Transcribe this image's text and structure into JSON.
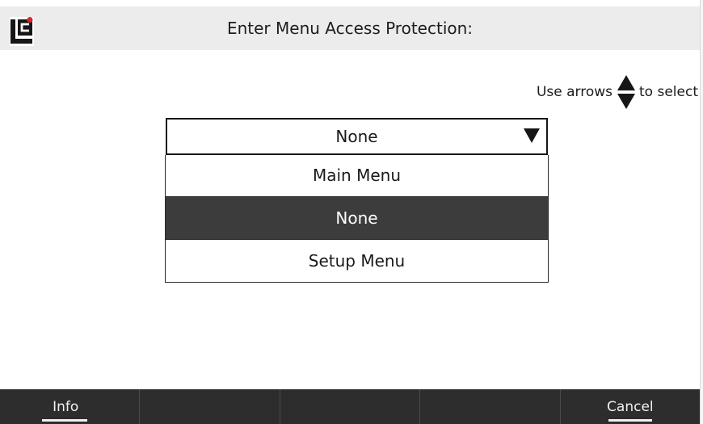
{
  "header": {
    "title": "Enter Menu Access Protection:",
    "logo_icon": "lc-logo-icon",
    "logo_accent": "#e0232b"
  },
  "hint": {
    "prefix": "Use arrows",
    "suffix": "to select",
    "icon": "up-down-arrows-icon"
  },
  "dropdown": {
    "current_value": "None",
    "caret_icon": "caret-down-icon",
    "options": [
      {
        "label": "Main Menu",
        "selected": false
      },
      {
        "label": "None",
        "selected": true
      },
      {
        "label": "Setup Menu",
        "selected": false
      }
    ]
  },
  "softkeys": [
    {
      "label": "Info"
    },
    {
      "label": ""
    },
    {
      "label": ""
    },
    {
      "label": ""
    },
    {
      "label": "Cancel"
    }
  ],
  "colors": {
    "selected_bg": "#3c3c3c",
    "softkey_bar": "#2d2d2d",
    "titlebar": "#ececec"
  }
}
